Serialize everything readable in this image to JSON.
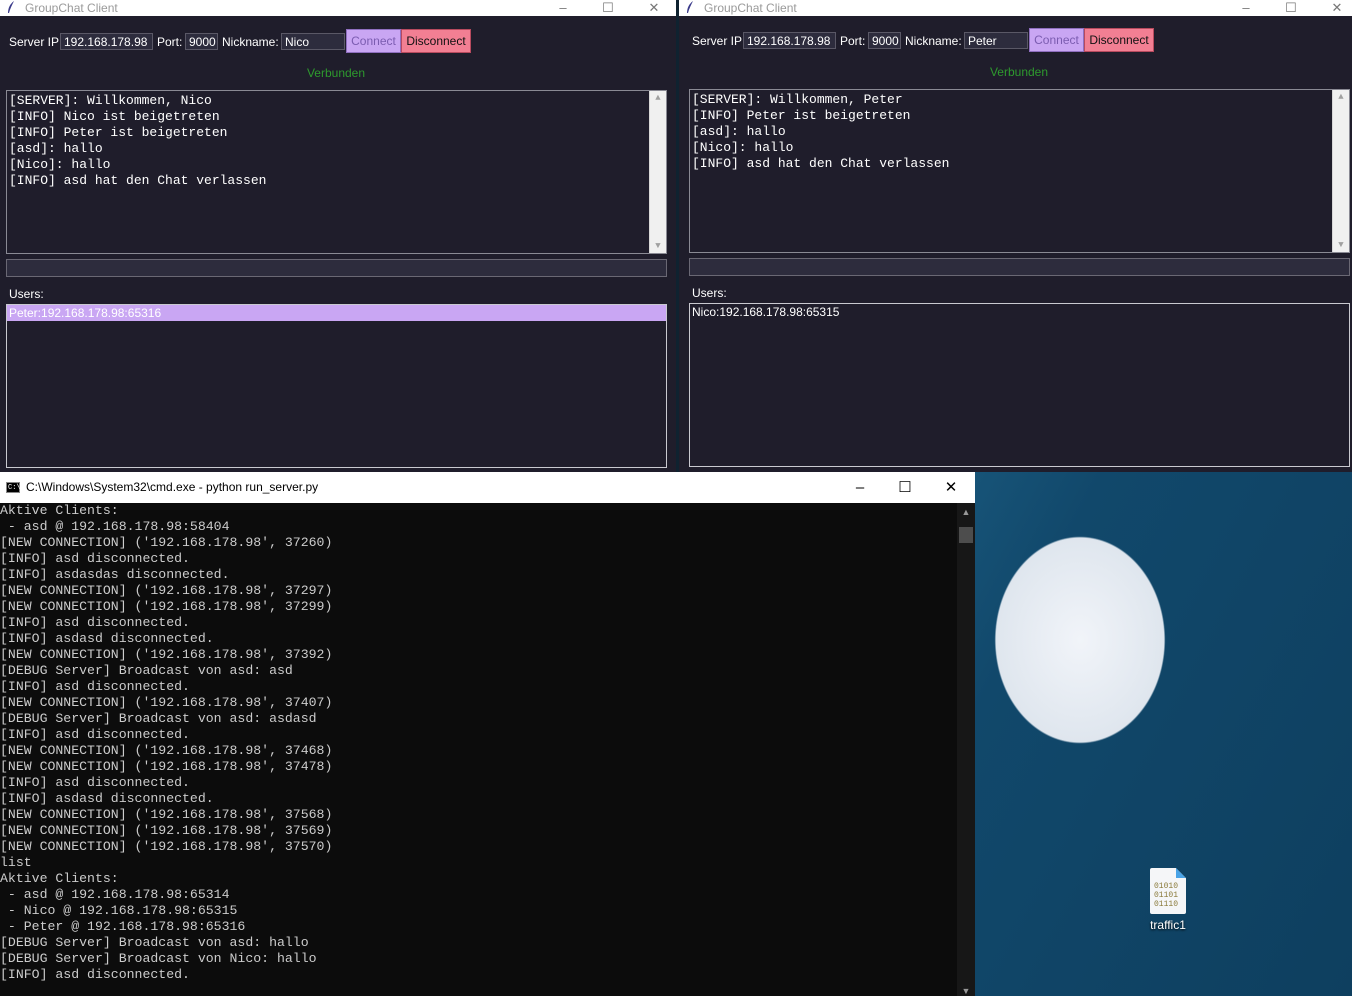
{
  "colors": {
    "window_bg": "#1f1d2b",
    "connect_bg": "#c9a6f3",
    "disconnect_bg": "#f27f93",
    "status_green": "#2e9a2e",
    "selection": "#c9a6f3",
    "console_bg": "#0c0c0c"
  },
  "client_left": {
    "title": "GroupChat Client",
    "server_ip_label": "Server IP:",
    "server_ip_value": "192.168.178.98",
    "port_label": "Port:",
    "port_value": "9000",
    "nickname_label": "Nickname:",
    "nickname_value": "Nico",
    "connect_label": "Connect",
    "disconnect_label": "Disconnect",
    "status": "Verbunden",
    "chat_lines": [
      "[SERVER]: Willkommen, Nico",
      "[INFO] Nico ist beigetreten",
      "[INFO] Peter ist beigetreten",
      "[asd]: hallo",
      "[Nico]: hallo",
      "[INFO] asd hat den Chat verlassen"
    ],
    "users_label": "Users:",
    "users": [
      "Peter:192.168.178.98:65316"
    ]
  },
  "client_right": {
    "title": "GroupChat Client",
    "server_ip_label": "Server IP:",
    "server_ip_value": "192.168.178.98",
    "port_label": "Port:",
    "port_value": "9000",
    "nickname_label": "Nickname:",
    "nickname_value": "Peter",
    "connect_label": "Connect",
    "disconnect_label": "Disconnect",
    "status": "Verbunden",
    "chat_lines": [
      "[SERVER]: Willkommen, Peter",
      "[INFO] Peter ist beigetreten",
      "[asd]: hallo",
      "[Nico]: hallo",
      "[INFO] asd hat den Chat verlassen"
    ],
    "users_label": "Users:",
    "users": [
      "Nico:192.168.178.98:65315"
    ]
  },
  "console": {
    "title": "C:\\Windows\\System32\\cmd.exe - python  run_server.py",
    "icon_text": "C:\\",
    "lines": [
      "Aktive Clients:",
      " - asd @ 192.168.178.98:58404",
      "[NEW CONNECTION] ('192.168.178.98', 37260)",
      "[INFO] asd disconnected.",
      "[INFO] asdasdas disconnected.",
      "[NEW CONNECTION] ('192.168.178.98', 37297)",
      "[NEW CONNECTION] ('192.168.178.98', 37299)",
      "[INFO] asd disconnected.",
      "[INFO] asdasd disconnected.",
      "[NEW CONNECTION] ('192.168.178.98', 37392)",
      "[DEBUG Server] Broadcast von asd: asd",
      "[INFO] asd disconnected.",
      "[NEW CONNECTION] ('192.168.178.98', 37407)",
      "[DEBUG Server] Broadcast von asd: asdasd",
      "[INFO] asd disconnected.",
      "[NEW CONNECTION] ('192.168.178.98', 37468)",
      "[NEW CONNECTION] ('192.168.178.98', 37478)",
      "[INFO] asd disconnected.",
      "[INFO] asdasd disconnected.",
      "[NEW CONNECTION] ('192.168.178.98', 37568)",
      "[NEW CONNECTION] ('192.168.178.98', 37569)",
      "[NEW CONNECTION] ('192.168.178.98', 37570)",
      "list",
      "Aktive Clients:",
      " - asd @ 192.168.178.98:65314",
      " - Nico @ 192.168.178.98:65315",
      " - Peter @ 192.168.178.98:65316",
      "[DEBUG Server] Broadcast von asd: hallo",
      "[DEBUG Server] Broadcast von Nico: hallo",
      "[INFO] asd disconnected."
    ]
  },
  "desktop": {
    "icon_label": "traffic1",
    "icon_glyph_lines": [
      "01010",
      "01101",
      "01110"
    ]
  },
  "icons": {
    "minimize": "–",
    "maximize": "☐",
    "close": "✕",
    "scroll_up": "▲",
    "scroll_down": "▼"
  }
}
